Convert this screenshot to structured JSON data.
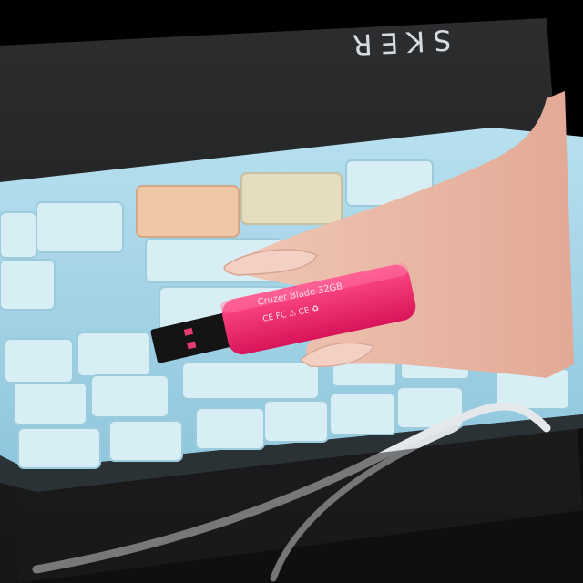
{
  "scene": {
    "keyboard_brand": "SKER",
    "usb_drive": {
      "label": "Cruzer Blade 32GB",
      "markings": "CE FC ⚠ CE ♻"
    }
  },
  "colors": {
    "keyboard_body": "#a9d7ea",
    "keycap": "#d7eef5",
    "accent_keycap_orange": "#f0c7a5",
    "accent_keycap_beige": "#e6dcc0",
    "usb_drive_pink": "#f0236b",
    "usb_connector": "#141414",
    "cable": "#e5e8ea",
    "background": "#1f1f20"
  }
}
